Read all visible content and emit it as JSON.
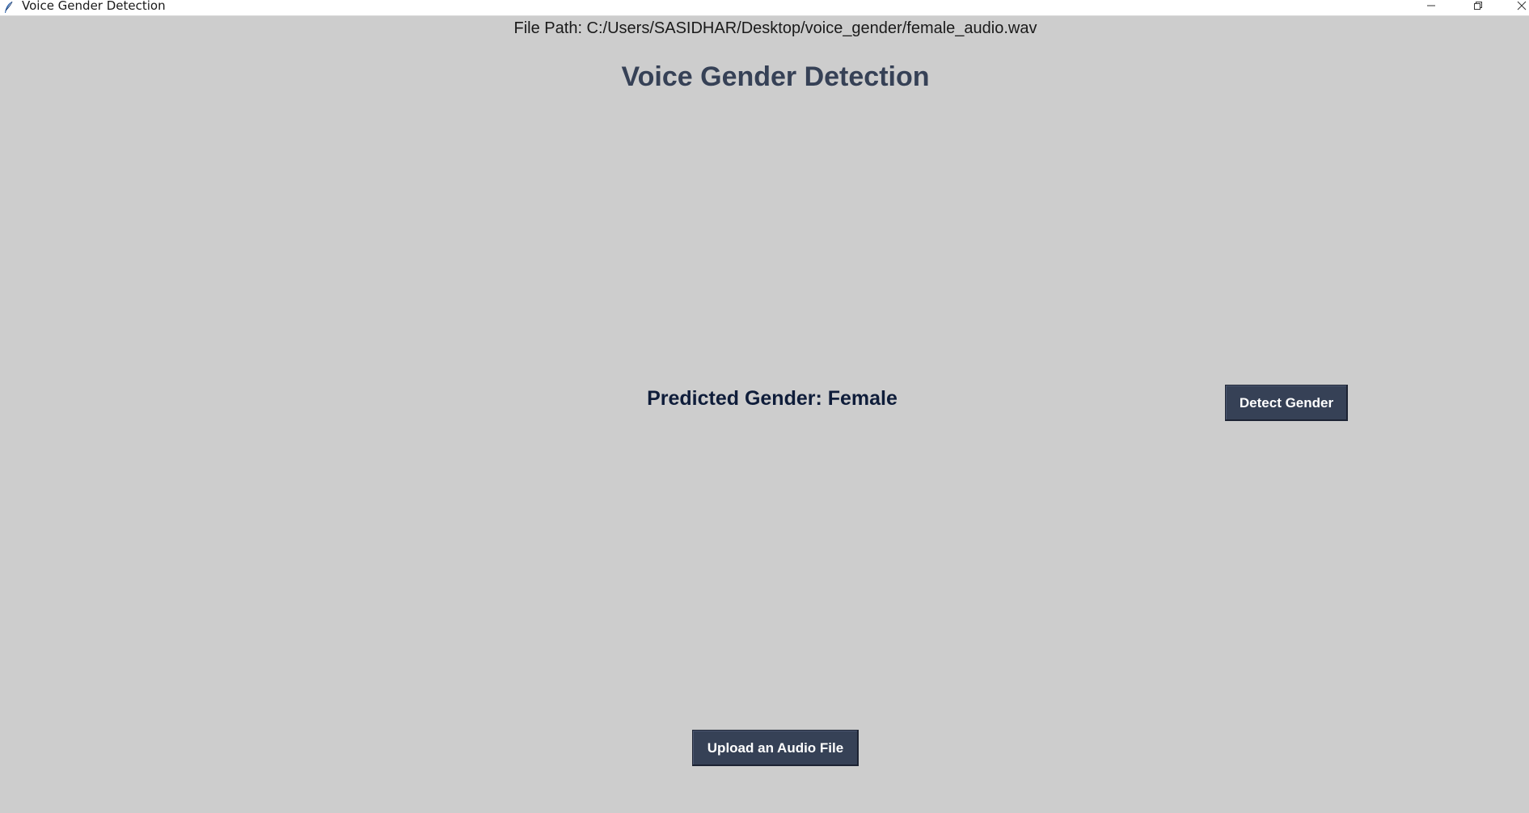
{
  "window": {
    "title": "Voice Gender Detection",
    "app_icon": "feather-icon",
    "controls": [
      "minimize-icon",
      "restore-icon",
      "close-icon"
    ]
  },
  "main": {
    "file_path": "File Path: C:/Users/SASIDHAR/Desktop/voice_gender/female_audio.wav",
    "title": "Voice Gender Detection",
    "prediction": "Predicted Gender: Female",
    "detect_button": "Detect Gender",
    "upload_button": "Upload an Audio File"
  },
  "colors": {
    "background": "#cdcdcd",
    "button": "#364156",
    "title_text": "#364156",
    "prediction_text": "#0f1d3a"
  }
}
